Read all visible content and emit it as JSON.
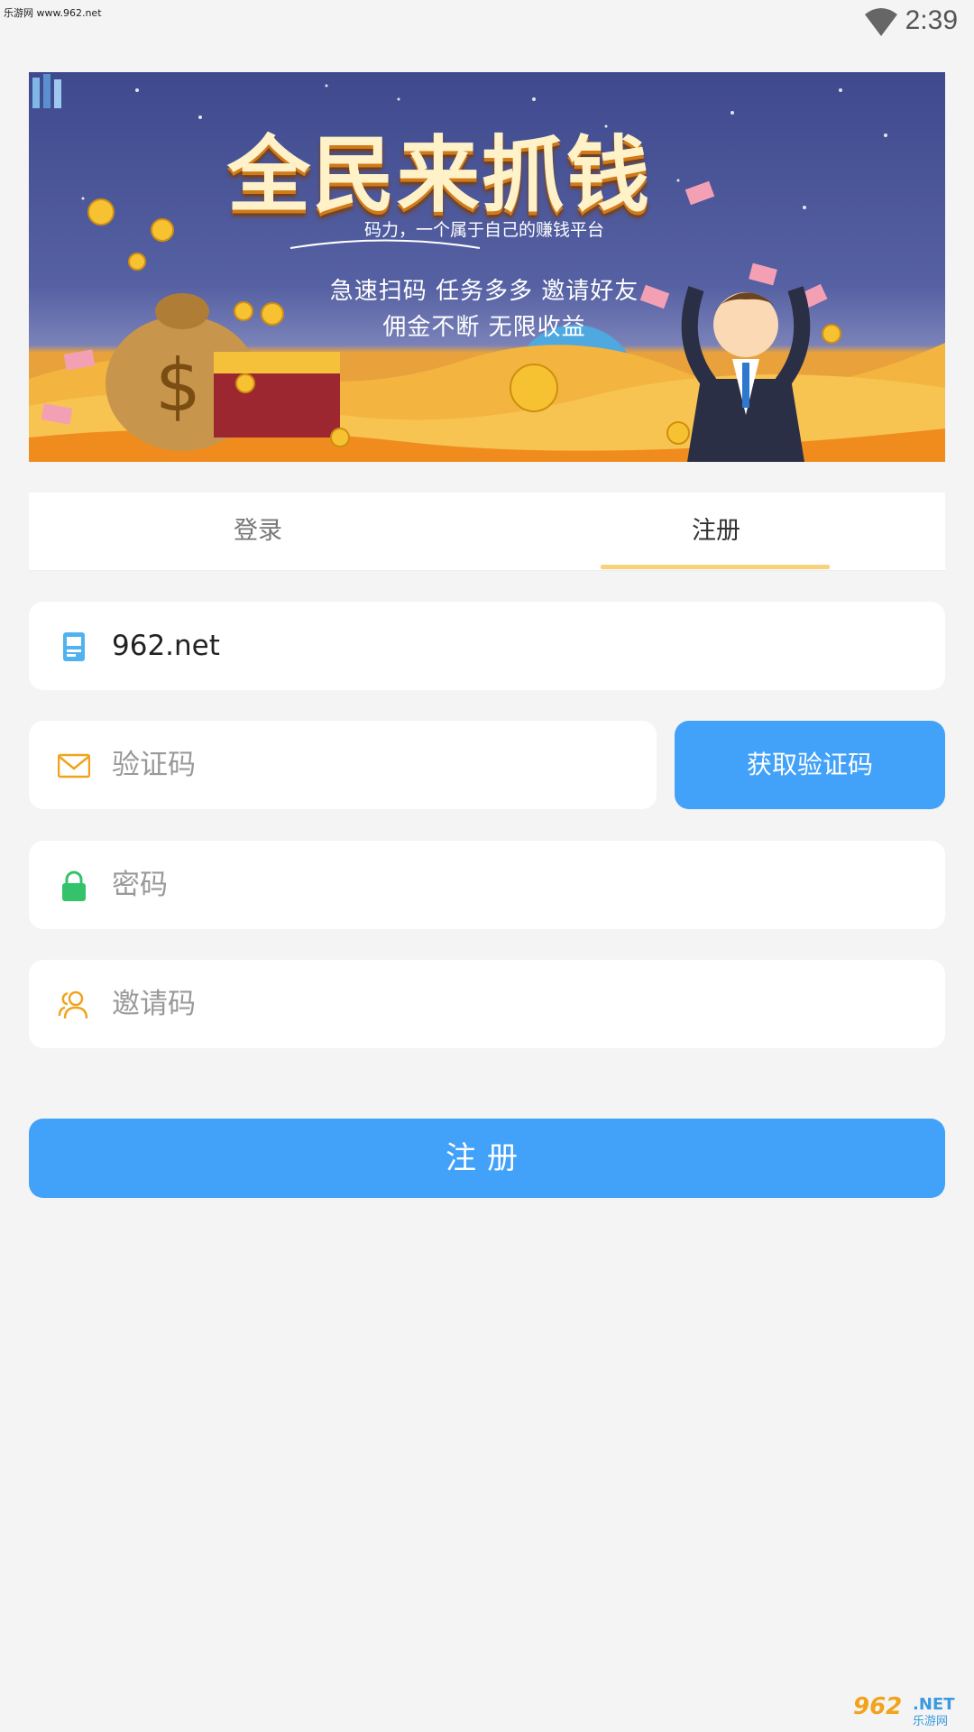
{
  "status_bar": {
    "watermark": "乐游网 www.962.net",
    "time": "2:39",
    "wifi_icon": "wifi-icon"
  },
  "banner": {
    "title": "全民来抓钱",
    "subtitle": "码力，一个属于自己的赚钱平台",
    "line1": "急速扫码  任务多多  邀请好友",
    "line2": "佣金不断  无限收益"
  },
  "tabs": [
    {
      "label": "登录",
      "active": false
    },
    {
      "label": "注册",
      "active": true
    }
  ],
  "form": {
    "phone": {
      "value": "962.net",
      "icon": "phone-icon"
    },
    "code": {
      "placeholder": "验证码",
      "icon": "mail-icon"
    },
    "get_code_label": "获取验证码",
    "password": {
      "placeholder": "密码",
      "icon": "lock-icon"
    },
    "invite": {
      "placeholder": "邀请码",
      "icon": "users-icon"
    },
    "submit_label": "注册"
  },
  "watermark_bottom": {
    "brand": "962",
    "net": ".NET",
    "site": "乐游网"
  },
  "colors": {
    "accent_blue": "#42a1f8",
    "tab_underline": "#f8d27a",
    "background": "#f4f4f4",
    "phone_icon": "#4fb3f0",
    "mail_icon": "#f2a31b",
    "lock_icon": "#34c36a",
    "users_icon": "#f2a31b"
  }
}
